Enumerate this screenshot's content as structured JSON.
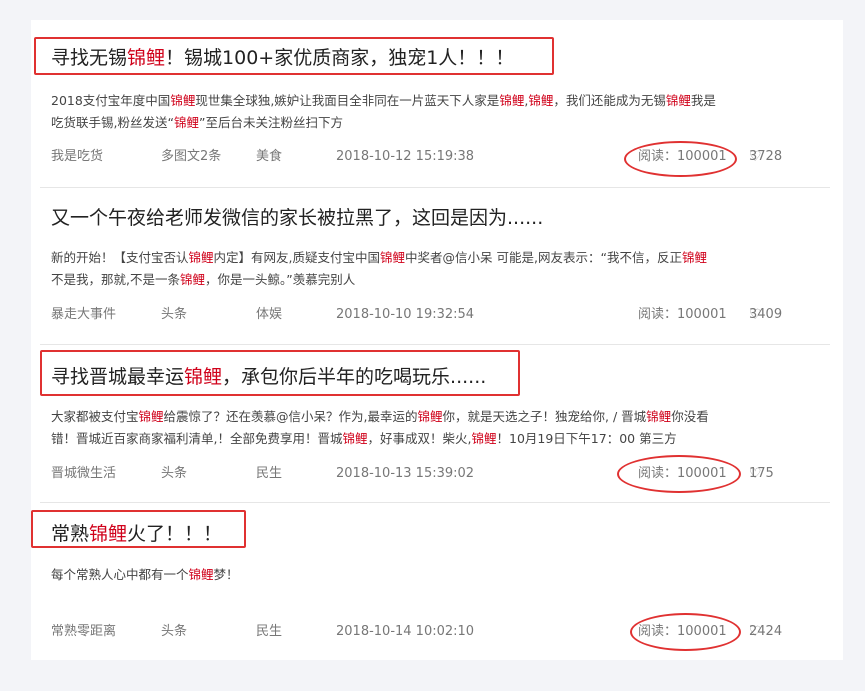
{
  "articles": [
    {
      "title_parts": [
        "寻找无锡",
        "锦鲤",
        "！锡城100+家优质商家，独宠1人！！！"
      ],
      "summary_line1_parts": [
        "2018支付宝年度中国",
        "锦鲤",
        "现世集全球独,嫉妒让我面目全非同在一片蓝天下人家是",
        "锦鲤",
        ",",
        "锦鲤",
        "，我们还能成为无锡",
        "锦鲤",
        "我是"
      ],
      "summary_line2_parts": [
        "吃货联手锡,粉丝发送“",
        "锦鲤",
        "”至后台未关注粉丝扫下方"
      ],
      "author": "我是吃货",
      "type": "多图文2条",
      "category": "美食",
      "date": "2018-10-12 15:19:38",
      "reads": "阅读：100001",
      "likes": "3728"
    },
    {
      "title": "又一个午夜给老师发微信的家长被拉黑了，这回是因为......",
      "summary_line1_parts": [
        "新的开始！【支付宝否认",
        "锦鲤",
        "内定】有网友,质疑支付宝中国",
        "锦鲤",
        "中奖者@信小呆 可能是,网友表示：“我不信，反正",
        "锦鲤"
      ],
      "summary_line2_parts": [
        "不是我，那就,不是一条",
        "锦鲤",
        "，你是一头鲸。”羡慕完别人"
      ],
      "author": "暴走大事件",
      "type": "头条",
      "category": "体娱",
      "date": "2018-10-10 19:32:54",
      "reads": "阅读：100001",
      "likes": "3409"
    },
    {
      "title_parts": [
        "寻找晋城最幸运",
        "锦鲤",
        "，承包你后半年的吃喝玩乐......"
      ],
      "summary_line1_parts": [
        "大家都被支付宝",
        "锦鲤",
        "给震惊了？还在羡慕@信小呆？作为,最幸运的",
        "锦鲤",
        "你，就是天选之子！独宠给你, / 晋城",
        "锦鲤",
        "你没看"
      ],
      "summary_line2_parts": [
        "错！晋城近百家商家福利清单,！全部免费享用！晋城",
        "锦鲤",
        "，好事成双！柴火,",
        "锦鲤",
        "！10月19日下午17：00 第三方"
      ],
      "author": "晋城微生活",
      "type": "头条",
      "category": "民生",
      "date": "2018-10-13 15:39:02",
      "reads": "阅读：100001",
      "likes": "175"
    },
    {
      "title_parts": [
        "常熟",
        "锦鲤",
        "火了！！！"
      ],
      "summary_line1_parts": [
        "每个常熟人心中都有一个",
        "锦鲤",
        "梦！"
      ],
      "author": "常熟零距离",
      "type": "头条",
      "category": "民生",
      "date": "2018-10-14 10:02:10",
      "reads": "阅读：100001",
      "likes": "2424"
    }
  ],
  "icons": {
    "like": "heart-outline-icon"
  },
  "colors": {
    "highlight": "#d0021b",
    "annotation": "#e03131"
  }
}
